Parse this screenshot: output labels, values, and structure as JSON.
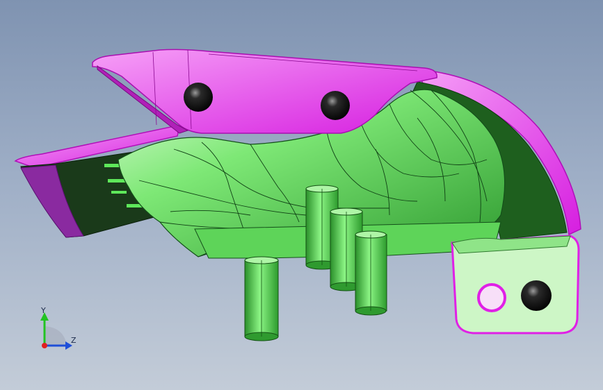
{
  "viewport": {
    "background_top": "#7f93b1",
    "background_bottom": "#c3ccd8"
  },
  "model": {
    "colors": {
      "part_green": "#4fe04a",
      "part_green_light": "#b9f5b0",
      "part_green_dark": "#1f7a22",
      "edge_magenta": "#e020e6",
      "flange_magenta": "#f06af4",
      "pin_green": "#39d535",
      "ball_black": "#111111"
    }
  },
  "triad": {
    "y_label": "Y",
    "z_label": "Z",
    "y_color": "#22c322",
    "z_color": "#1f4fd8",
    "x_color": "#e02020"
  }
}
